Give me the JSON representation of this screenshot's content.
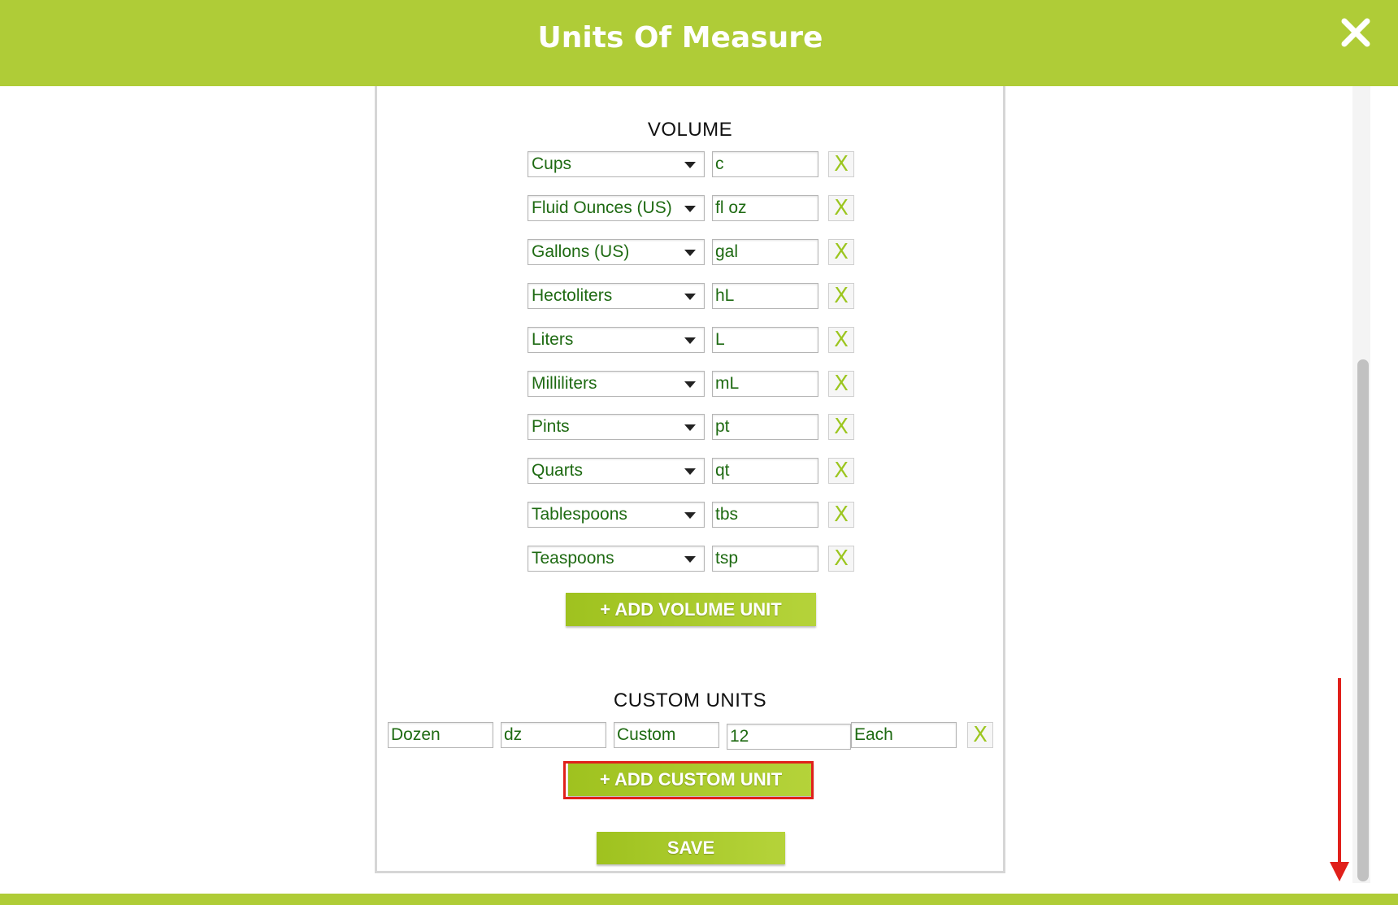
{
  "header": {
    "title": "Units Of Measure",
    "close_icon": "close-icon"
  },
  "volume": {
    "title": "VOLUME",
    "rows": [
      {
        "unit": "Cups",
        "abbr": "c"
      },
      {
        "unit": "Fluid Ounces (US)",
        "abbr": "fl oz"
      },
      {
        "unit": "Gallons (US)",
        "abbr": "gal"
      },
      {
        "unit": "Hectoliters",
        "abbr": "hL"
      },
      {
        "unit": "Liters",
        "abbr": "L"
      },
      {
        "unit": "Milliliters",
        "abbr": "mL"
      },
      {
        "unit": "Pints",
        "abbr": "pt"
      },
      {
        "unit": "Quarts",
        "abbr": "qt"
      },
      {
        "unit": "Tablespoons",
        "abbr": "tbs"
      },
      {
        "unit": "Teaspoons",
        "abbr": "tsp"
      }
    ],
    "remove_label": "X",
    "add_button": "+ ADD VOLUME UNIT"
  },
  "custom": {
    "title": "CUSTOM UNITS",
    "row": {
      "name": "Dozen",
      "abbr": "dz",
      "type": "Custom",
      "quantity": "12",
      "base": "Each",
      "remove_label": "X"
    },
    "add_button": "+ ADD CUSTOM UNIT"
  },
  "save_button": "SAVE",
  "colors": {
    "brand_green": "#afcc37",
    "text_green": "#1e6a12",
    "annotation_red": "#e0201b"
  }
}
